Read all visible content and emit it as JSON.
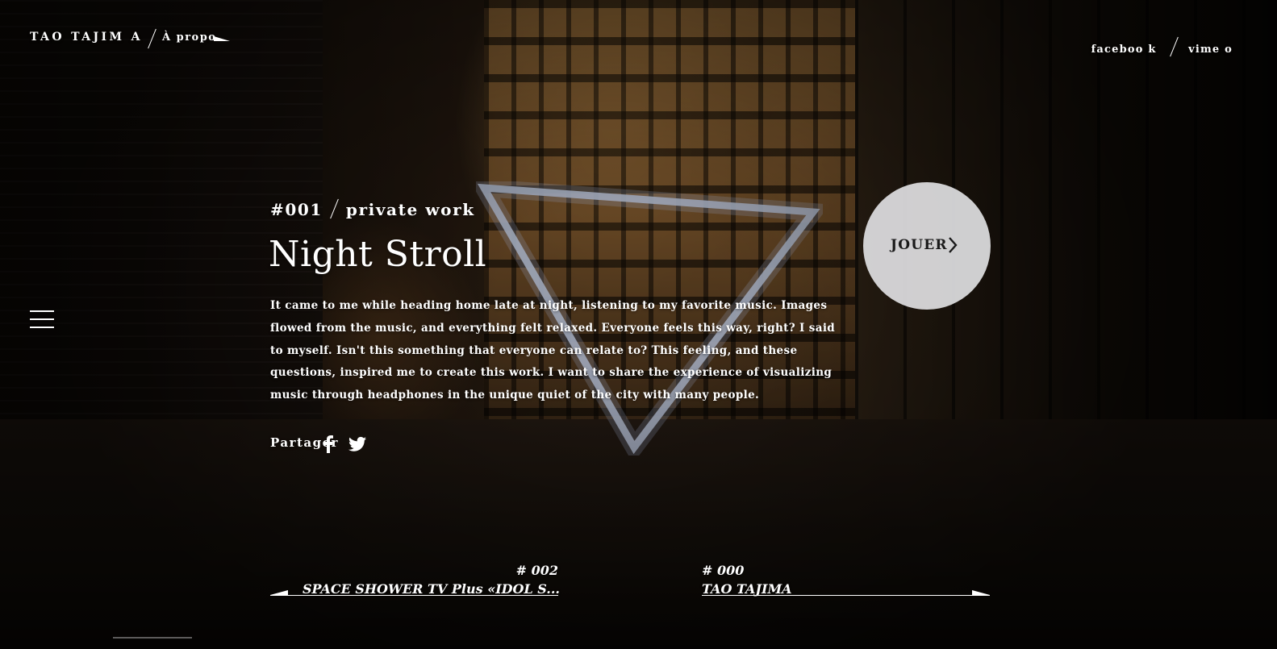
{
  "header": {
    "brand": "TAO TAJIM A",
    "about_label": "À propo",
    "social": {
      "facebook_label": "faceboo k",
      "vimeo_label": "vime o"
    }
  },
  "work": {
    "number": "#001",
    "category": "private work",
    "title": "Night Stroll",
    "description": "It came to me while heading home late at night, listening to my favorite music. Images flowed from the music, and everything felt relaxed. Everyone feels this way, right? I said to myself. Isn't this something that everyone can relate to? This feeling, and these questions, inspired me to create this work. I want to share the experience of visualizing music through headphones in the unique quiet of the city with many people.",
    "share_label": "Partager"
  },
  "play": {
    "label": "JOUER"
  },
  "pager": {
    "prev": {
      "number": "# 002",
      "title": "SPACE SHOWER TV Plus «IDOL S..."
    },
    "next": {
      "number": "# 000",
      "title": "TAO TAJIMA"
    }
  },
  "colors": {
    "accent": "#ffffff",
    "play_circle": "#e0e0e2",
    "background": "#000000"
  },
  "icons": {
    "menu": "hamburger-icon",
    "facebook": "facebook-icon",
    "twitter": "twitter-icon",
    "play_chevron": "chevron-right-icon"
  }
}
